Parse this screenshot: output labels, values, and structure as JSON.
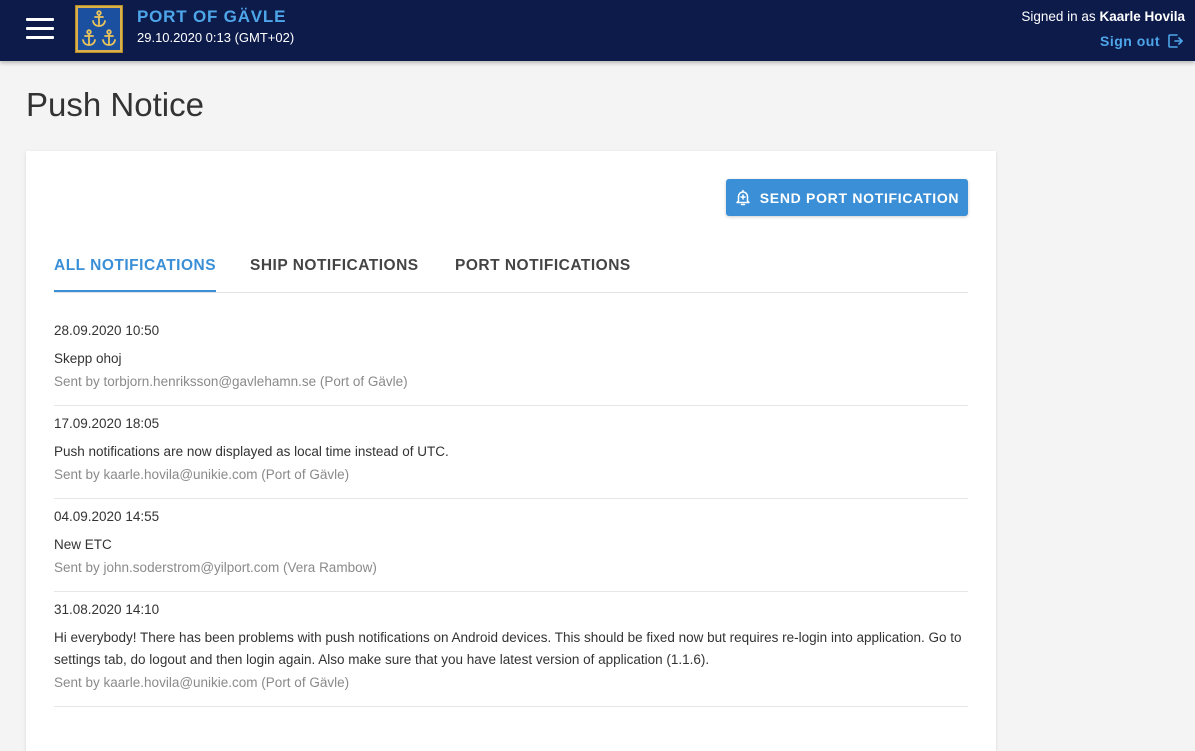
{
  "header": {
    "port_name": "PORT OF GÄVLE",
    "datetime": "29.10.2020 0:13 (GMT+02)",
    "signed_in_prefix": "Signed in as",
    "user_name": "Kaarle Hovila",
    "sign_out_label": "Sign out"
  },
  "page": {
    "title": "Push Notice"
  },
  "actions": {
    "send_label": "SEND PORT NOTIFICATION"
  },
  "tabs": [
    {
      "label": "ALL NOTIFICATIONS",
      "active": true
    },
    {
      "label": "SHIP NOTIFICATIONS",
      "active": false
    },
    {
      "label": "PORT NOTIFICATIONS",
      "active": false
    }
  ],
  "notifications": [
    {
      "date": "28.09.2020 10:50",
      "message": "Skepp ohoj",
      "sender": "Sent by torbjorn.henriksson@gavlehamn.se (Port of Gävle)"
    },
    {
      "date": "17.09.2020 18:05",
      "message": "Push notifications are now displayed as local time instead of UTC.",
      "sender": "Sent by kaarle.hovila@unikie.com (Port of Gävle)"
    },
    {
      "date": "04.09.2020 14:55",
      "message": "New ETC",
      "sender": "Sent by john.soderstrom@yilport.com (Vera Rambow)"
    },
    {
      "date": "31.08.2020 14:10",
      "message": "Hi everybody! There has been problems with push notifications on Android devices. This should be fixed now but requires re-login into application. Go to settings tab, do logout and then login again. Also make sure that you have latest version of application (1.1.6).",
      "sender": "Sent by kaarle.hovila@unikie.com (Port of Gävle)"
    }
  ],
  "colors": {
    "topbar": "#0d1b4b",
    "accent": "#3a8fd6",
    "brand_text": "#4ea6ea"
  },
  "icons": {
    "menu": "hamburger-menu-icon",
    "logo": "anchor-crest-logo",
    "sign_out": "sign-out-icon",
    "send": "bell-plus-icon"
  }
}
